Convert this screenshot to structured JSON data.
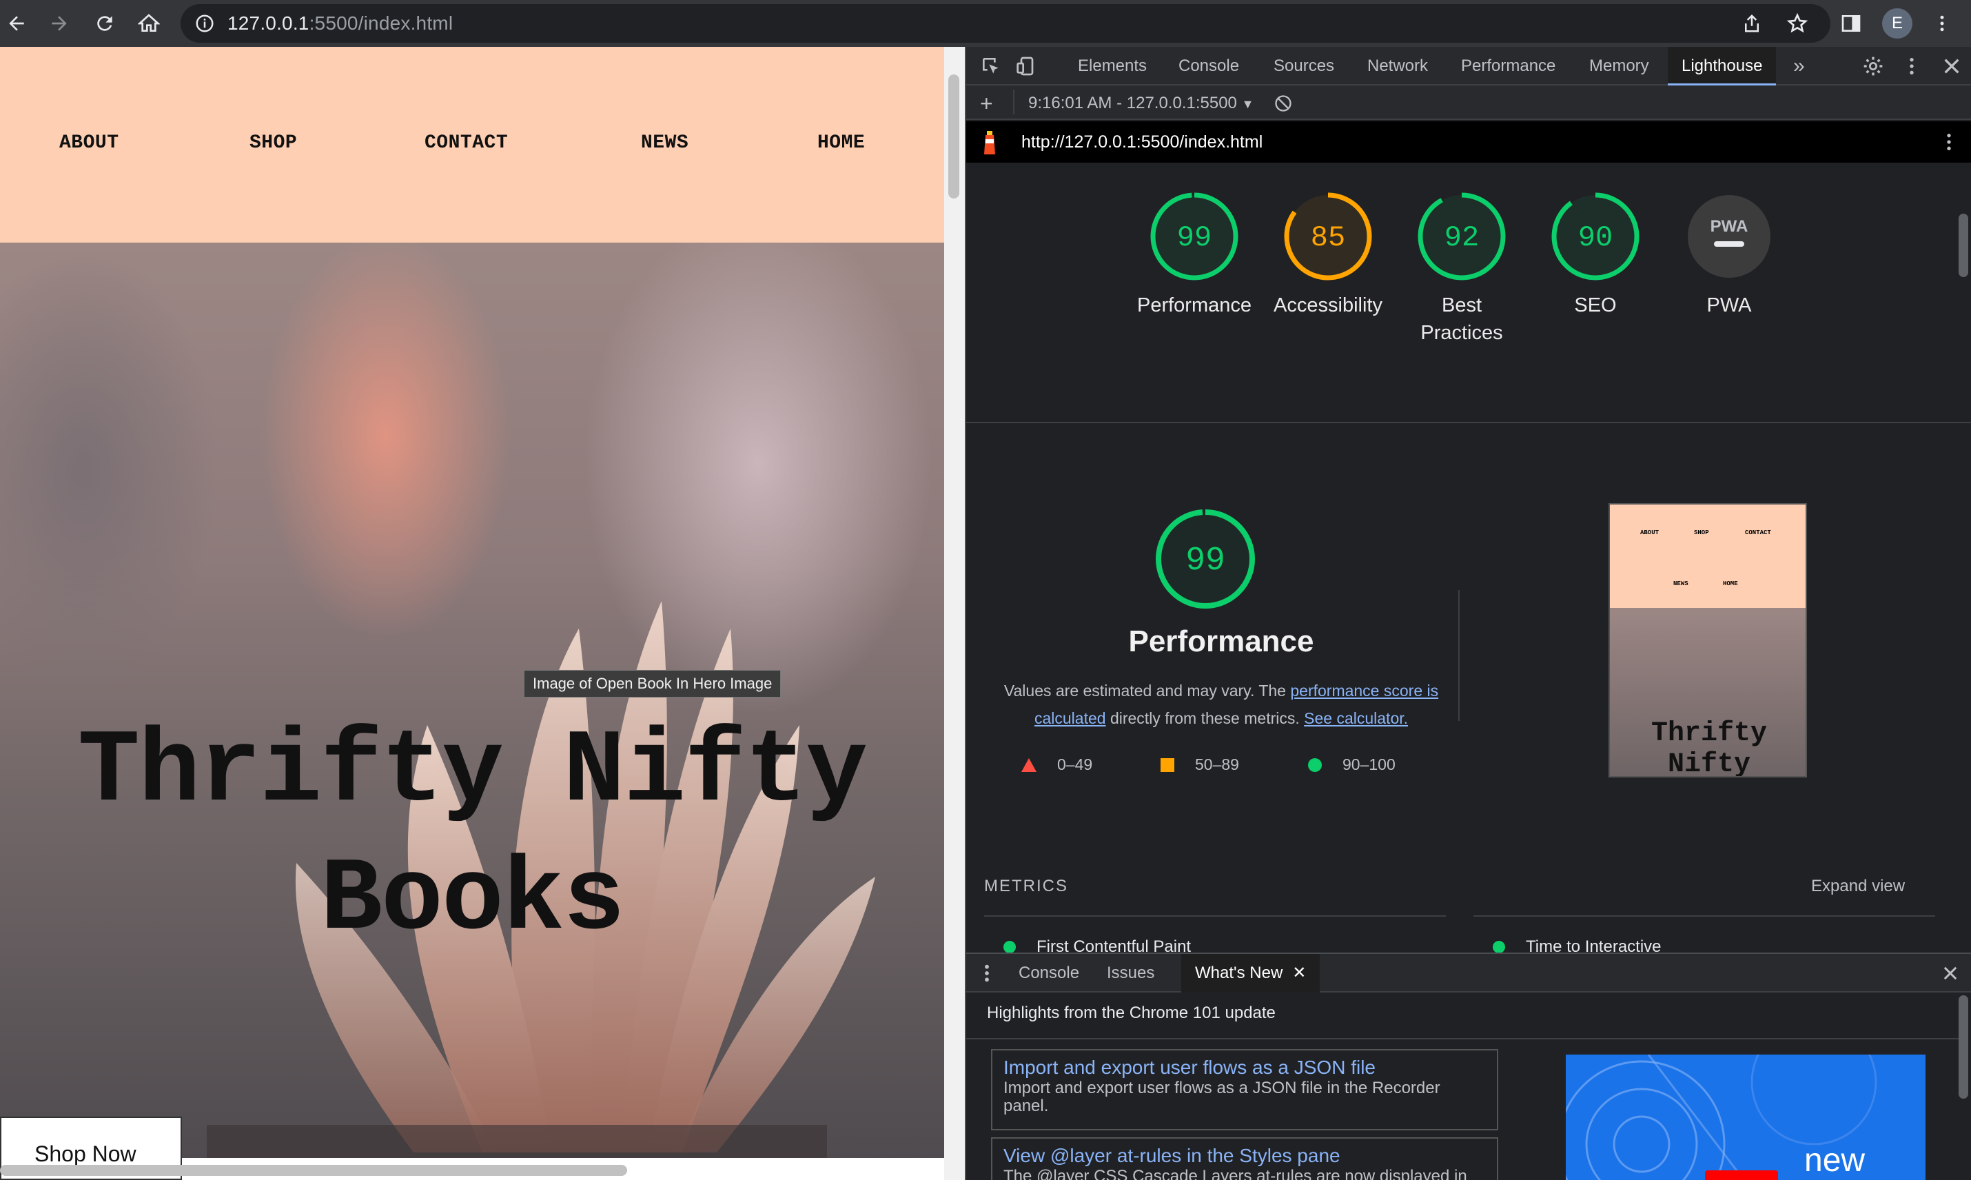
{
  "browser": {
    "url_host": "127.0.0.1",
    "url_rest": ":5500/index.html",
    "avatar_letter": "E"
  },
  "page": {
    "nav": [
      "ABOUT",
      "SHOP",
      "CONTACT",
      "NEWS",
      "HOME"
    ],
    "tooltip": "Image of Open Book In Hero Image",
    "title_line1": "Thrifty Nifty",
    "title_line2": "Books",
    "shop_button": "Shop Now"
  },
  "devtools": {
    "tabs": [
      "Elements",
      "Console",
      "Sources",
      "Network",
      "Performance",
      "Memory",
      "Lighthouse"
    ],
    "active_tab": "Lighthouse",
    "report_select": "9:16:01 AM - 127.0.0.1:5500",
    "report_url": "http://127.0.0.1:5500/index.html",
    "gauges": [
      {
        "score": 99,
        "label": "Performance",
        "color": "#0cce6b"
      },
      {
        "score": 85,
        "label": "Accessibility",
        "color": "#ffa400"
      },
      {
        "score": 92,
        "label": "Best Practices",
        "color": "#0cce6b"
      },
      {
        "score": 90,
        "label": "SEO",
        "color": "#0cce6b"
      },
      {
        "score": null,
        "label": "PWA",
        "badge": "PWA",
        "color": "#9aa0a6"
      }
    ],
    "performance": {
      "score": 99,
      "title": "Performance",
      "desc_1": "Values are estimated and may vary. The ",
      "desc_link1": "performance score is calculated",
      "desc_2": " directly from these metrics. ",
      "desc_link2": "See calculator.",
      "legend": [
        {
          "range": "0–49",
          "color": "#ff4e42",
          "shape": "triangle"
        },
        {
          "range": "50–89",
          "color": "#ffa400",
          "shape": "square"
        },
        {
          "range": "90–100",
          "color": "#0cce6b",
          "shape": "circle"
        }
      ]
    },
    "metrics_header": "METRICS",
    "expand_view": "Expand view",
    "metrics": [
      "First Contentful Paint",
      "Time to Interactive"
    ],
    "thumbnail": {
      "nav_row1": [
        "ABOUT",
        "SHOP",
        "CONTACT"
      ],
      "nav_row2": [
        "NEWS",
        "HOME"
      ],
      "title": "Thrifty Nifty"
    },
    "drawer": {
      "tabs": [
        "Console",
        "Issues",
        "What's New"
      ],
      "active_tab": "What's New",
      "highlights": "Highlights from the Chrome 101 update",
      "cards": [
        {
          "title": "Import and export user flows as a JSON file",
          "desc": "Import and export user flows as a JSON file in the Recorder panel."
        },
        {
          "title": "View @layer at-rules in the Styles pane",
          "desc": "The @layer CSS Cascade Layers at-rules are now displayed in the Styles pane."
        }
      ],
      "video_text": "new"
    }
  }
}
